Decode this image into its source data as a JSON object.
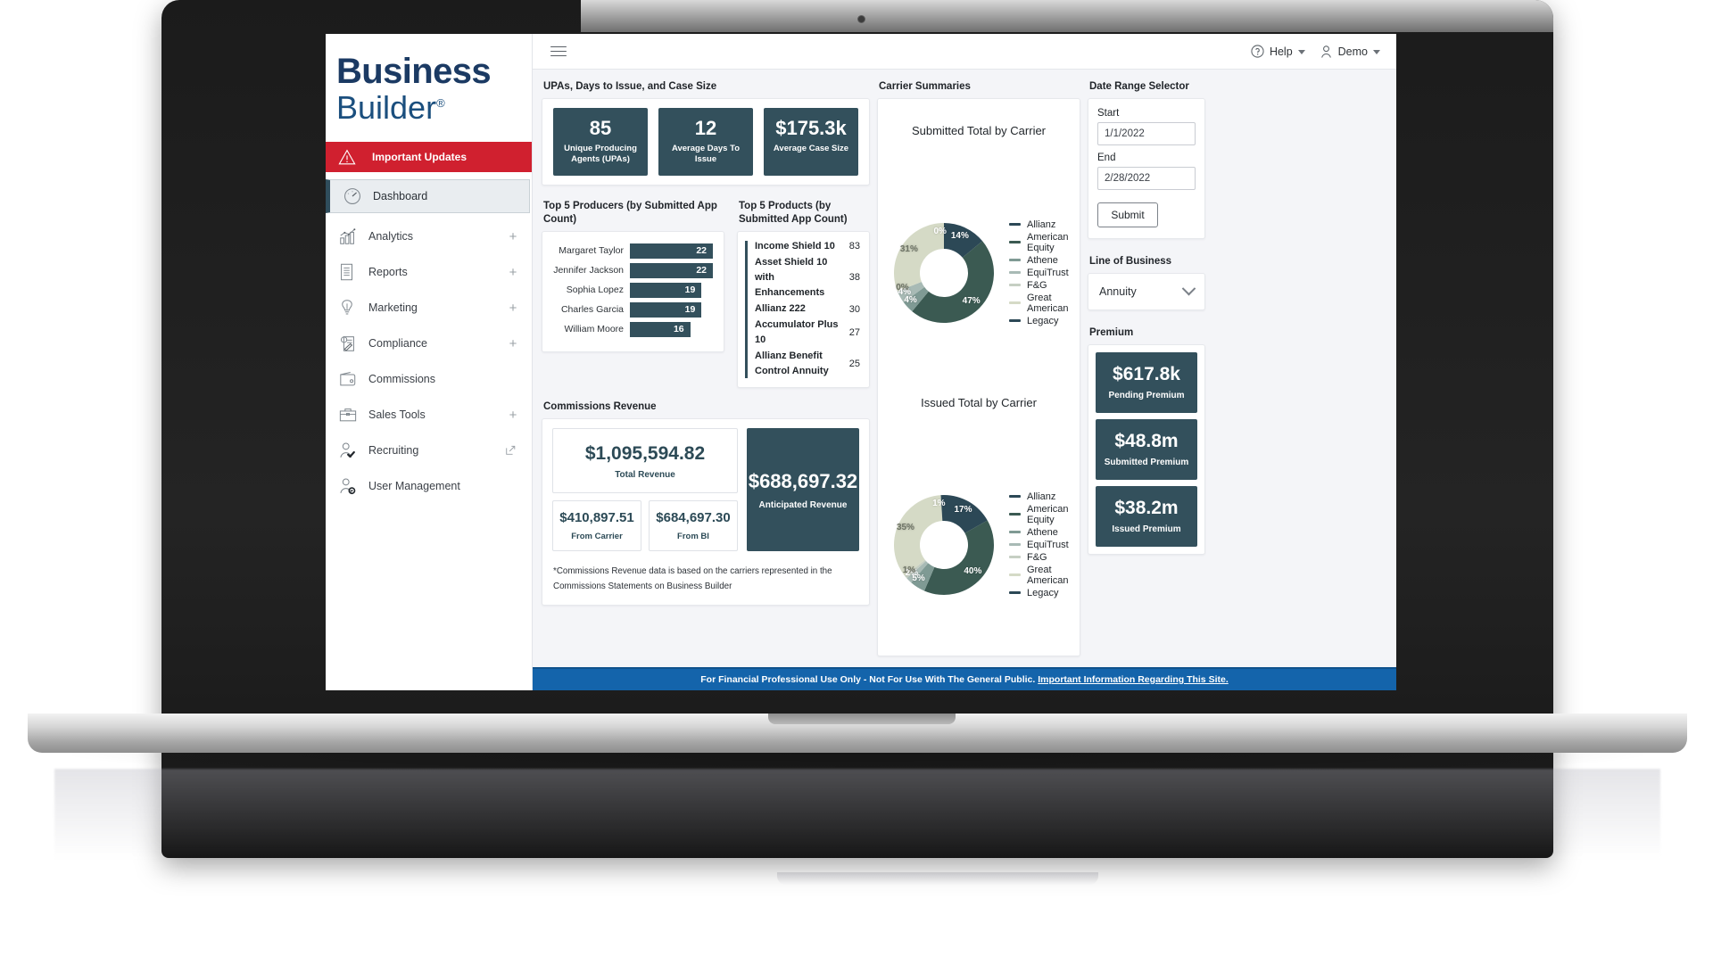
{
  "sidebar": {
    "logo_line1": "Business",
    "logo_line2": "Builder",
    "logo_mark": "®",
    "items": [
      {
        "label": "Important Updates",
        "icon": "warning-triangle-icon",
        "suffix": ""
      },
      {
        "label": "Dashboard",
        "icon": "gauge-icon",
        "suffix": ""
      },
      {
        "label": "Analytics",
        "icon": "bar-chart-icon",
        "suffix": "+"
      },
      {
        "label": "Reports",
        "icon": "document-icon",
        "suffix": "+"
      },
      {
        "label": "Marketing",
        "icon": "lightbulb-icon",
        "suffix": "+"
      },
      {
        "label": "Compliance",
        "icon": "clipboard-pen-icon",
        "suffix": "+"
      },
      {
        "label": "Commissions",
        "icon": "wallet-icon",
        "suffix": ""
      },
      {
        "label": "Sales Tools",
        "icon": "briefcase-icon",
        "suffix": "+"
      },
      {
        "label": "Recruiting",
        "icon": "person-check-icon",
        "suffix": "external-link-icon"
      },
      {
        "label": "User Management",
        "icon": "person-gear-icon",
        "suffix": ""
      }
    ]
  },
  "topbar": {
    "help_label": "Help",
    "user_label": "Demo"
  },
  "upas": {
    "title": "UPAs, Days to Issue, and Case Size",
    "cards": [
      {
        "value": "85",
        "label": "Unique Producing Agents (UPAs)"
      },
      {
        "value": "12",
        "label": "Average Days To Issue"
      },
      {
        "value": "$175.3k",
        "label": "Average Case Size"
      }
    ]
  },
  "producers": {
    "title": "Top 5 Producers (by Submitted App Count)",
    "max": 22,
    "rows": [
      {
        "name": "Margaret Taylor",
        "value": 22
      },
      {
        "name": "Jennifer Jackson",
        "value": 22
      },
      {
        "name": "Sophia Lopez",
        "value": 19
      },
      {
        "name": "Charles Garcia",
        "value": 19
      },
      {
        "name": "William Moore",
        "value": 16
      }
    ]
  },
  "products": {
    "title": "Top 5 Products (by Submitted App Count)",
    "rows": [
      {
        "name": "Income Shield 10",
        "value": "83"
      },
      {
        "name": "Asset Shield 10 with Enhancements",
        "value": "38"
      },
      {
        "name": "Allianz 222",
        "value": "30"
      },
      {
        "name": "Accumulator Plus 10",
        "value": "27"
      },
      {
        "name": "Allianz Benefit Control Annuity",
        "value": "25"
      }
    ]
  },
  "commissions": {
    "title": "Commissions Revenue",
    "total": {
      "value": "$1,095,594.82",
      "label": "Total Revenue"
    },
    "from_carrier": {
      "value": "$410,897.51",
      "label": "From Carrier"
    },
    "from_bi": {
      "value": "$684,697.30",
      "label": "From BI"
    },
    "anticipated": {
      "value": "$688,697.32",
      "label": "Anticipated Revenue"
    },
    "note": "*Commissions Revenue data is based on the carriers represented in the Commissions Statements on Business Builder"
  },
  "carrier": {
    "title": "Carrier Summaries"
  },
  "date_range": {
    "title": "Date Range Selector",
    "start_label": "Start",
    "start_value": "1/1/2022",
    "end_label": "End",
    "end_value": "2/28/2022",
    "submit_label": "Submit"
  },
  "line_of_business": {
    "title": "Line of Business",
    "selected": "Annuity"
  },
  "premium": {
    "title": "Premium",
    "cards": [
      {
        "value": "$617.8k",
        "label": "Pending Premium"
      },
      {
        "value": "$48.8m",
        "label": "Submitted Premium"
      },
      {
        "value": "$38.2m",
        "label": "Issued Premium"
      }
    ]
  },
  "footer": {
    "text": "For Financial Professional Use Only - Not For Use With The General Public.",
    "link": "Important Information Regarding This Site."
  },
  "colors": {
    "brand_navy": "#1b3a63",
    "alert_red": "#d0202f",
    "teal_dark": "#33505c",
    "footer_blue": "#1464ab"
  },
  "chart_data": [
    {
      "type": "pie",
      "title": "Submitted Total by Carrier",
      "categories": [
        "Allianz",
        "American Equity",
        "Athene",
        "EquiTrust",
        "F&G",
        "Great American",
        "Legacy"
      ],
      "values": [
        14,
        47,
        4,
        4,
        0,
        31,
        0
      ],
      "labels": [
        "14%",
        "47%",
        "4%",
        "4%",
        "0%",
        "31%",
        "0%"
      ],
      "colors": [
        "#2c4856",
        "#3b5a52",
        "#7f9a94",
        "#a8bab5",
        "#c6cfc3",
        "#d5dac6",
        "#2c4856"
      ],
      "legend_position": "right",
      "donut": true
    },
    {
      "type": "pie",
      "title": "Issued Total by Carrier",
      "categories": [
        "Allianz",
        "American Equity",
        "Athene",
        "EquiTrust",
        "F&G",
        "Great American",
        "Legacy"
      ],
      "values": [
        17,
        40,
        5,
        2,
        1,
        35,
        1
      ],
      "labels": [
        "17%",
        "40%",
        "5%",
        "2%",
        "1%",
        "35%",
        "1%"
      ],
      "colors": [
        "#2c4856",
        "#3b5a52",
        "#7f9a94",
        "#a8bab5",
        "#c6cfc3",
        "#d5dac6",
        "#2c4856"
      ],
      "legend_position": "right",
      "donut": true
    }
  ]
}
